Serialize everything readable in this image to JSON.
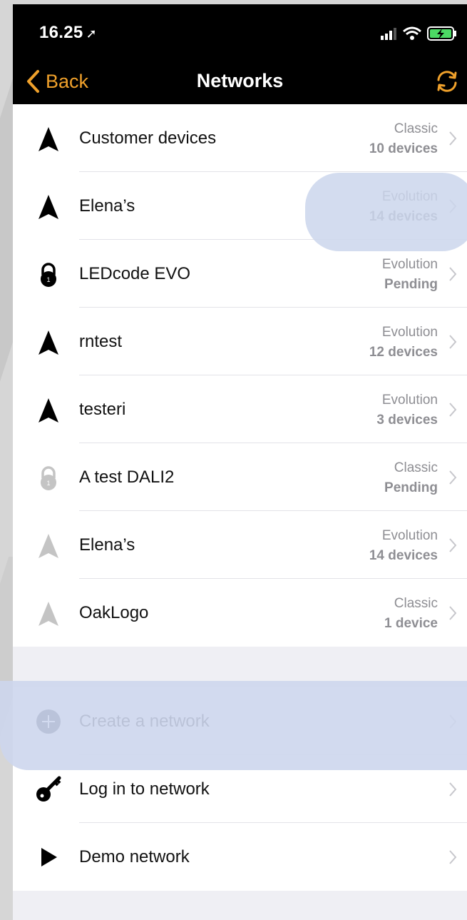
{
  "status_bar": {
    "time": "16.25"
  },
  "nav": {
    "back_label": "Back",
    "title": "Networks"
  },
  "networks": [
    {
      "name": "Customer devices",
      "type": "Classic",
      "status": "10 devices",
      "icon": "network-logo-icon",
      "active": true
    },
    {
      "name": "Elena’s",
      "type": "Evolution",
      "status": "14 devices",
      "icon": "network-logo-icon",
      "active": true
    },
    {
      "name": "LEDcode  EVO",
      "type": "Evolution",
      "status": "Pending",
      "icon": "lock-icon",
      "active": true
    },
    {
      "name": "rntest",
      "type": "Evolution",
      "status": "12 devices",
      "icon": "network-logo-icon",
      "active": true
    },
    {
      "name": "testeri",
      "type": "Evolution",
      "status": "3 devices",
      "icon": "network-logo-icon",
      "active": true
    },
    {
      "name": "A test DALI2",
      "type": "Classic",
      "status": "Pending",
      "icon": "lock-icon",
      "active": false
    },
    {
      "name": "Elena’s",
      "type": "Evolution",
      "status": "14 devices",
      "icon": "network-logo-icon",
      "active": false
    },
    {
      "name": "OakLogo",
      "type": "Classic",
      "status": "1 device",
      "icon": "network-logo-icon",
      "active": false
    }
  ],
  "actions": [
    {
      "label": "Create a network",
      "icon": "plus-circle-icon"
    },
    {
      "label": "Log in to network",
      "icon": "key-icon"
    },
    {
      "label": "Demo network",
      "icon": "play-icon"
    }
  ],
  "colors": {
    "accent": "#f0a12b",
    "nav_bg": "#000000",
    "highlight": "#cbd6ec",
    "secondary_text": "#8e8e93",
    "inactive_icon": "#c4c4c4"
  }
}
